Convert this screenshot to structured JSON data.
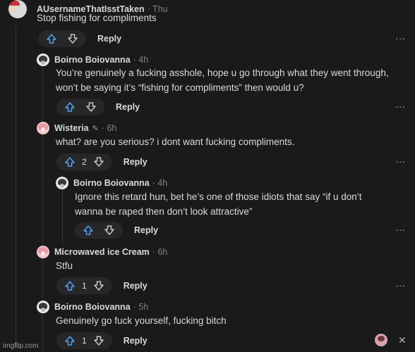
{
  "colors": {
    "upvote": "#4fa3f7",
    "downvote": "#c5c7c9",
    "background": "#1a1a1b"
  },
  "labels": {
    "reply": "Reply",
    "more": "∙∙∙"
  },
  "comments": [
    {
      "author": "AUsernameThatIsstTaken",
      "time": "Thu",
      "text_lines": [
        "Stop fishing for compliments"
      ],
      "score": "",
      "avatar": "cap"
    },
    {
      "author": "Boirno Boiovanna",
      "time": "4h",
      "text_lines": [
        "You’re genuinely a fucking asshole, hope u go through what they went through,",
        "won’t be saying it’s “fishing for compliments” then would u?"
      ],
      "score": "",
      "avatar": "mono"
    },
    {
      "author": "Wisteria",
      "edited_icon": "pencil-icon",
      "time": "6h",
      "text_lines": [
        "what? are you serious? i dont want fucking compliments."
      ],
      "score": "2",
      "avatar": "pink"
    },
    {
      "author": "Boirno Boiovanna",
      "time": "4h",
      "text_lines": [
        "Ignore this retard hun, bet he’s one of those idiots that say “if u don’t",
        "wanna be raped then don’t look attractive”"
      ],
      "score": "",
      "avatar": "mono"
    },
    {
      "author": "Microwaved ice Cream",
      "time": "6h",
      "text_lines": [
        "Stfu"
      ],
      "score": "1",
      "avatar": "pink"
    },
    {
      "author": "Boirno Boiovanna",
      "time": "5h",
      "text_lines": [
        "Genuinely go fuck yourself, fucking bitch"
      ],
      "score": "1",
      "avatar": "mono"
    }
  ],
  "watermark": "imgflip.com",
  "footer": {
    "close_icon": "close-icon"
  }
}
